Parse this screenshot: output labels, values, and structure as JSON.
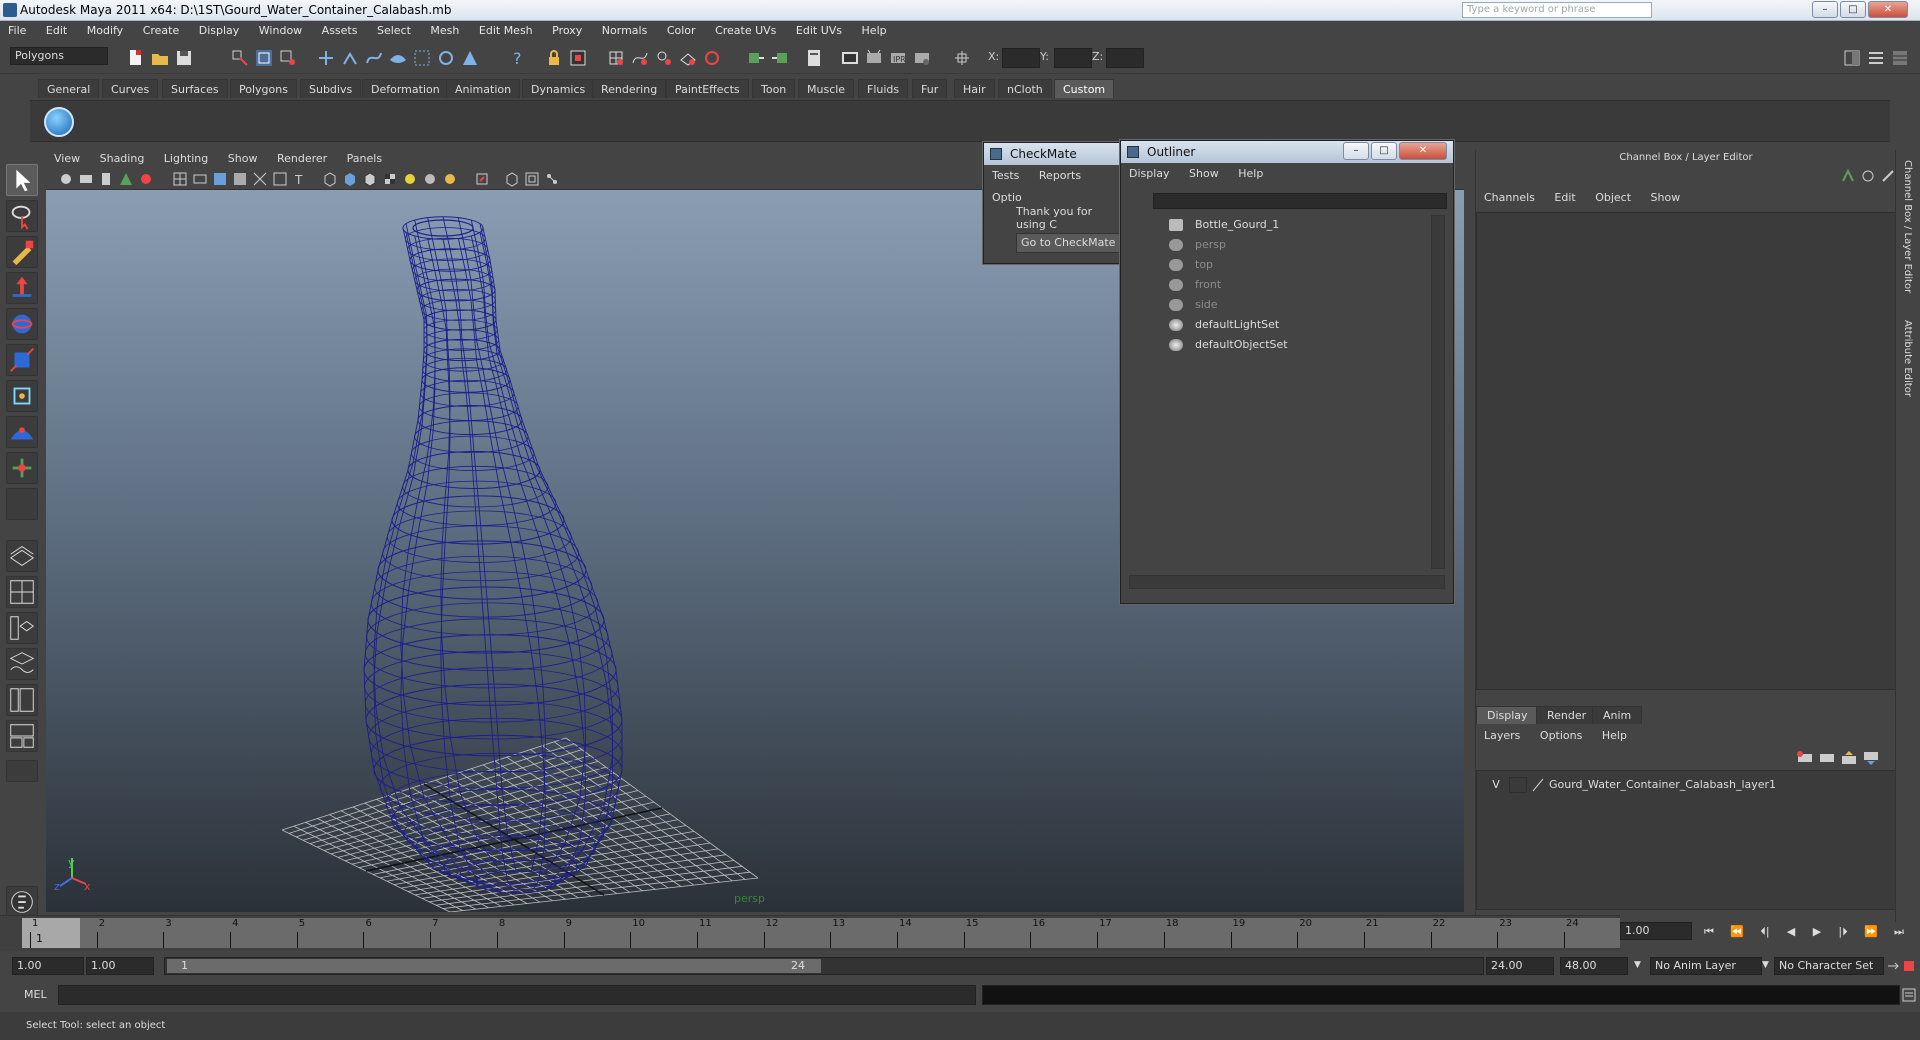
{
  "window": {
    "title": "Autodesk Maya 2011 x64: D:\\1ST\\Gourd_Water_Container_Calabash.mb",
    "search_placeholder": "Type a keyword or phrase",
    "minimize": "–",
    "maximize": "□",
    "close": "✕"
  },
  "menubar": [
    "File",
    "Edit",
    "Modify",
    "Create",
    "Display",
    "Window",
    "Assets",
    "Select",
    "Mesh",
    "Edit Mesh",
    "Proxy",
    "Normals",
    "Color",
    "Create UVs",
    "Edit UVs",
    "Help"
  ],
  "toolbar": {
    "menuset": "Polygons",
    "x_label": "X:",
    "y_label": "Y:",
    "z_label": "Z:"
  },
  "shelf_tabs": [
    "General",
    "Curves",
    "Surfaces",
    "Polygons",
    "Subdivs",
    "Deformation",
    "Animation",
    "Dynamics",
    "Rendering",
    "PaintEffects",
    "Toon",
    "Muscle",
    "Fluids",
    "Fur",
    "Hair",
    "nCloth",
    "Custom"
  ],
  "shelf_active": "Custom",
  "viewport": {
    "menu": [
      "View",
      "Shading",
      "Lighting",
      "Show",
      "Renderer",
      "Panels"
    ],
    "camera_label": "persp",
    "axis_y": "y",
    "axis_x": "x",
    "axis_z": "z"
  },
  "checkmate": {
    "title": "CheckMate",
    "menu": [
      "Tests",
      "Reports",
      "Optio"
    ],
    "message": "Thank you for using C",
    "button": "Go to CheckMate Fo"
  },
  "outliner": {
    "title": "Outliner",
    "menu": [
      "Display",
      "Show",
      "Help"
    ],
    "items": [
      {
        "label": "Bottle_Gourd_1",
        "dim": false,
        "icon": "mesh-icon"
      },
      {
        "label": "persp",
        "dim": true,
        "icon": "camera-icon"
      },
      {
        "label": "top",
        "dim": true,
        "icon": "camera-icon"
      },
      {
        "label": "front",
        "dim": true,
        "icon": "camera-icon"
      },
      {
        "label": "side",
        "dim": true,
        "icon": "camera-icon"
      },
      {
        "label": "defaultLightSet",
        "dim": false,
        "icon": "set-icon"
      },
      {
        "label": "defaultObjectSet",
        "dim": false,
        "icon": "set-icon"
      }
    ]
  },
  "channel_box": {
    "header": "Channel Box / Layer Editor",
    "menu": [
      "Channels",
      "Edit",
      "Object",
      "Show"
    ],
    "layer_tabs": [
      "Display",
      "Render",
      "Anim"
    ],
    "layer_active": "Display",
    "layer_menu": [
      "Layers",
      "Options",
      "Help"
    ],
    "layer_row": {
      "visible": "V",
      "name": "Gourd_Water_Container_Calabash_layer1"
    },
    "side_tabs": [
      "Channel Box / Layer Editor",
      "Attribute Editor"
    ]
  },
  "timeline": {
    "ticks": [
      "1",
      "2",
      "3",
      "4",
      "5",
      "6",
      "7",
      "8",
      "9",
      "10",
      "11",
      "12",
      "13",
      "14",
      "15",
      "16",
      "17",
      "18",
      "19",
      "20",
      "21",
      "22",
      "23",
      "24"
    ],
    "current_marker": "1",
    "current_frame": "1.00",
    "playback": [
      "⏮",
      "⏪",
      "⏴|",
      "◀",
      "▶",
      "|⏵",
      "⏩",
      "⏭"
    ]
  },
  "range": {
    "start": "1.00",
    "playback_start": "1.00",
    "slider_start": "1",
    "slider_end": "24",
    "playback_end": "24.00",
    "end": "48.00",
    "anim_layer": "No Anim Layer",
    "character_set": "No Character Set"
  },
  "command": {
    "label": "MEL"
  },
  "help_line": "Select Tool: select an object",
  "colors": {
    "wireframe": "#1d1f8a",
    "grid": "#bfbfbf",
    "accent": "#5a5a5a"
  }
}
